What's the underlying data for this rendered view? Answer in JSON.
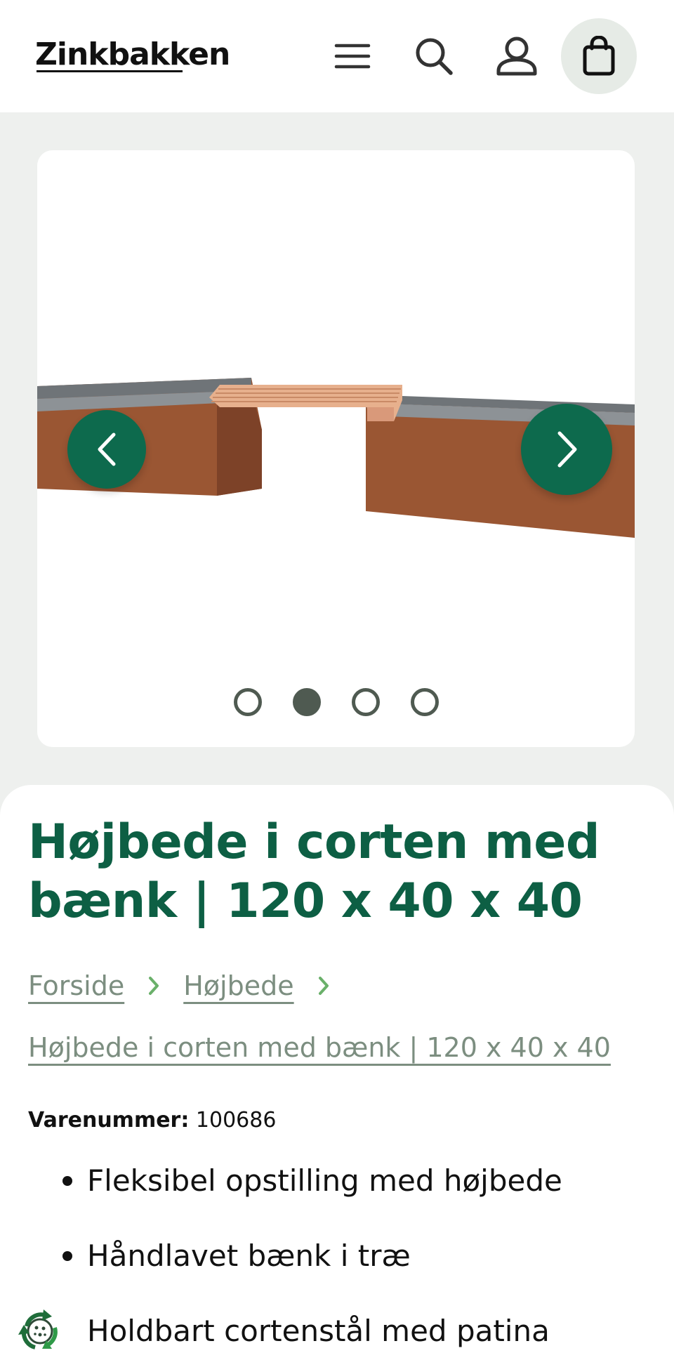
{
  "header": {
    "logo_text": "Zinkbakken",
    "icons": [
      "menu-icon",
      "search-icon",
      "account-icon",
      "cart-icon"
    ]
  },
  "gallery": {
    "slide_count": 4,
    "active_slide": 2
  },
  "product": {
    "title": "Højbede i corten med bænk | 120 x 40 x 40",
    "breadcrumb": {
      "home": "Forside",
      "category": "Højbede",
      "current": "Højbede i corten med bænk | 120 x 40 x 40"
    },
    "sku_label": "Varenummer:",
    "sku_value": "100686",
    "features": [
      "Fleksibel opstilling med højbede",
      "Håndlavet bænk i træ",
      "Holdbart cortenstål med patina"
    ]
  },
  "colors": {
    "brand_green": "#0d6a4d",
    "title_green": "#0d5f44",
    "breadcrumb_grey": "#7c8e80",
    "corten": "#8a4a2b"
  }
}
